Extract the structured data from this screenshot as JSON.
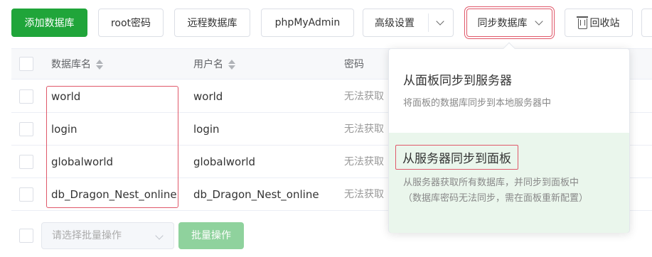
{
  "toolbar": {
    "add_db": "添加数据库",
    "root_pwd": "root密码",
    "remote_db": "远程数据库",
    "phpmyadmin": "phpMyAdmin",
    "advanced": "高级设置",
    "sync_db": "同步数据库",
    "recycle_bin": "回收站"
  },
  "table": {
    "headers": {
      "db_name": "数据库名",
      "username": "用户名",
      "password": "密码"
    },
    "rows": [
      {
        "db_name": "world",
        "username": "world",
        "password": "无法获取"
      },
      {
        "db_name": "login",
        "username": "login",
        "password": "无法获取"
      },
      {
        "db_name": "globalworld",
        "username": "globalworld",
        "password": "无法获取"
      },
      {
        "db_name": "db_Dragon_Nest_online",
        "username": "db_Dragon_Nest_online",
        "password": "无法获取"
      }
    ]
  },
  "sync_menu": {
    "option1": {
      "title": "从面板同步到服务器",
      "desc": "将面板的数据库同步到本地服务器中"
    },
    "option2": {
      "title": "从服务器同步到面板",
      "desc_line1": "从服务器获取所有数据库，并同步到面板中",
      "desc_line2": "（数据库密码无法同步，需在面板重新配置）"
    }
  },
  "footer": {
    "batch_placeholder": "请选择批量操作",
    "batch_button": "批量操作"
  },
  "colors": {
    "primary": "#20a53a",
    "highlight": "#e0586a",
    "menu_hover": "#eaf6ec"
  }
}
